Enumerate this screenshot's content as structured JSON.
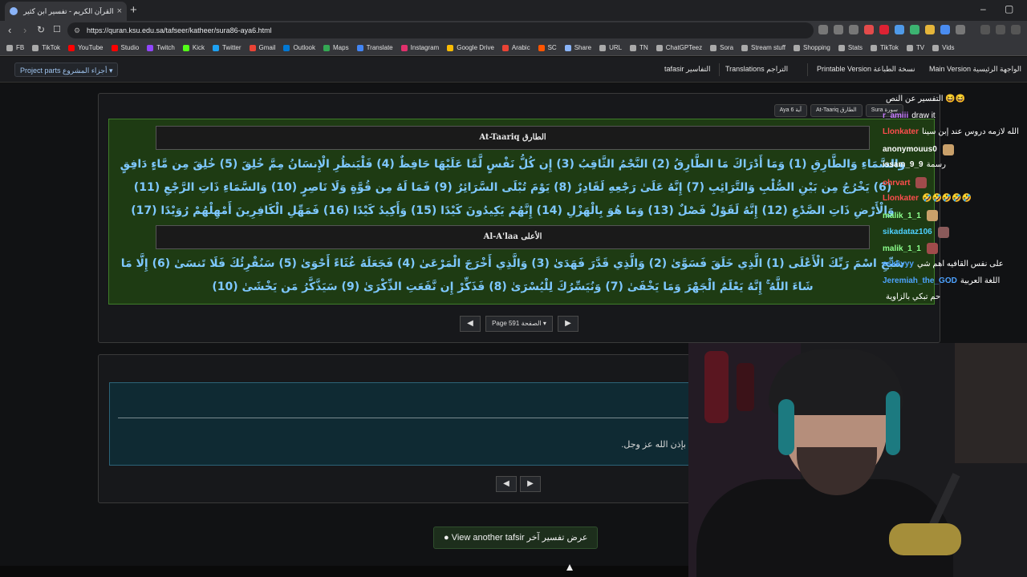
{
  "browser": {
    "tab_title": "القرآن الكريم - تفسير ابن كثير - تف...",
    "new_tab": "+",
    "url": "https://quran.ksu.edu.sa/tafseer/katheer/sura86-aya6.html",
    "window_controls": [
      "–",
      "▢"
    ]
  },
  "bookmarks": [
    {
      "label": "FB",
      "color": "#aaaaaa"
    },
    {
      "label": "TikTok",
      "color": "#aaaaaa"
    },
    {
      "label": "YouTube",
      "color": "#ff0000"
    },
    {
      "label": "Studio",
      "color": "#ff0000"
    },
    {
      "label": "Twitch",
      "color": "#9146ff"
    },
    {
      "label": "Kick",
      "color": "#53fc18"
    },
    {
      "label": "Twitter",
      "color": "#1da1f2"
    },
    {
      "label": "Gmail",
      "color": "#ea4335"
    },
    {
      "label": "Outlook",
      "color": "#0078d4"
    },
    {
      "label": "Maps",
      "color": "#34a853"
    },
    {
      "label": "Translate",
      "color": "#4285f4"
    },
    {
      "label": "Instagram",
      "color": "#e1306c"
    },
    {
      "label": "Google Drive",
      "color": "#fbbc04"
    },
    {
      "label": "Arabic",
      "color": "#ea4335"
    },
    {
      "label": "SC",
      "color": "#ff5500"
    },
    {
      "label": "Share",
      "color": "#8ab4f8"
    },
    {
      "label": "URL",
      "color": "#aaaaaa"
    },
    {
      "label": "TN",
      "color": "#aaaaaa"
    },
    {
      "label": "ChatGPTeez",
      "color": "#aaaaaa"
    },
    {
      "label": "Sora",
      "color": "#aaaaaa"
    },
    {
      "label": "Stream stuff",
      "color": "#aaaaaa"
    },
    {
      "label": "Shopping",
      "color": "#aaaaaa"
    },
    {
      "label": "Stats",
      "color": "#aaaaaa"
    },
    {
      "label": "TikTok",
      "color": "#aaaaaa"
    },
    {
      "label": "TV",
      "color": "#aaaaaa"
    },
    {
      "label": "Vids",
      "color": "#aaaaaa"
    }
  ],
  "sitenav": {
    "project_parts": "Project parts أجزاء المشروع ▾",
    "tafsir": "tafasir التفاسير",
    "translations": "Translations التراجم",
    "printable": "Printable Version نسخة الطباعة",
    "main": "Main Version الواجهة الرئيسية"
  },
  "crumbs": [
    "Sura سورة",
    "At-Taariq الطارق",
    "Aya 6 آية"
  ],
  "quran": {
    "sura1_title": "At-Taariq الطارق",
    "sura1_ayat": "وَالسَّمَاءِ وَالطَّارِقِ (1) وَمَا أَدْرَاكَ مَا الطَّارِقُ (2) النَّجْمُ الثَّاقِبُ (3) إِن كُلُّ نَفْسٍ لَّمَّا عَلَيْهَا حَافِظٌ (4) فَلْيَنظُرِ الْإِنسَانُ مِمَّ خُلِقَ (5) خُلِقَ مِن مَّاءٍ دَافِقٍ (6) يَخْرُجُ مِن بَيْنِ الصُّلْبِ وَالتَّرَائِبِ (7) إِنَّهُ عَلَىٰ رَجْعِهِ لَقَادِرٌ (8) يَوْمَ تُبْلَى السَّرَائِرُ (9) فَمَا لَهُ مِن قُوَّةٍ وَلَا نَاصِرٍ (10) وَالسَّمَاءِ ذَاتِ الرَّجْعِ (11) وَالْأَرْضِ ذَاتِ الصَّدْعِ (12) إِنَّهُ لَقَوْلٌ فَصْلٌ (13) وَمَا هُوَ بِالْهَزْلِ (14) إِنَّهُمْ يَكِيدُونَ كَيْدًا (15) وَأَكِيدُ كَيْدًا (16) فَمَهِّلِ الْكَافِرِينَ أَمْهِلْهُمْ رُوَيْدًا (17)",
    "sura2_title": "Al-A'laa الأعلى",
    "sura2_ayat": "سَبِّحِ اسْمَ رَبِّكَ الْأَعْلَى (1) الَّذِي خَلَقَ فَسَوَّىٰ (2) وَالَّذِي قَدَّرَ فَهَدَىٰ (3) وَالَّذِي أَخْرَجَ الْمَرْعَىٰ (4) فَجَعَلَهُ غُثَاءً أَحْوَىٰ (5) سَنُقْرِئُكَ فَلَا تَنسَىٰ (6) إِلَّا مَا شَاءَ اللَّهُ ۚ إِنَّهُ يَعْلَمُ الْجَهْرَ وَمَا يَخْفَىٰ (7) وَنُيَسِّرُكَ لِلْيُسْرَىٰ (8) فَذَكِّرْ إِن نَّفَعَتِ الذِّكْرَىٰ (9) سَيَذَّكَّرُ مَن يَخْشَىٰ (10)"
  },
  "pager": {
    "prev": "◀",
    "page_label": "Page 591 الصفحة ▾",
    "next": "▶"
  },
  "tafsir": {
    "text": "بإذن الله عز وجل."
  },
  "pager2": {
    "prev": "◀",
    "next": "▶"
  },
  "view_another": "View another tafsir عرض تفسير آخر",
  "chat": [
    {
      "user": "",
      "msg": "التفسير عن النص 😆😆",
      "color": "#ffffff"
    },
    {
      "user": "r_amiii",
      "msg": "draw it",
      "color": "#c77dff"
    },
    {
      "user": "Llonkater",
      "msg": "الله لازمه دروس عند إبن سينا",
      "color": "#ff4d4d"
    },
    {
      "user": "anonymouus0",
      "msg": "",
      "color": "#ffffff"
    },
    {
      "user": "issam_9_9",
      "msg": "رسمة",
      "color": "#ffffff"
    },
    {
      "user": "ohrvart",
      "msg": "",
      "color": "#ff4d4d"
    },
    {
      "user": "Llonkater",
      "msg": "🤣🤣🤣🤣🤣",
      "color": "#ff4d4d"
    },
    {
      "user": "malik_1_1",
      "msg": "",
      "color": "#8cff8c"
    },
    {
      "user": "sikadataz106",
      "msg": "",
      "color": "#4dd0ff"
    },
    {
      "user": "malik_1_1",
      "msg": "",
      "color": "#8cff8c"
    },
    {
      "user": "sskkyyy",
      "msg": "على نفس القافيه اهم شي",
      "color": "#4da3ff"
    },
    {
      "user": "Jeremiah_the_GOD",
      "msg": "اللغة العربية",
      "color": "#4da3ff"
    },
    {
      "user": "",
      "msg": "حم تبكي بالزاوية",
      "color": "#ffffff"
    }
  ]
}
